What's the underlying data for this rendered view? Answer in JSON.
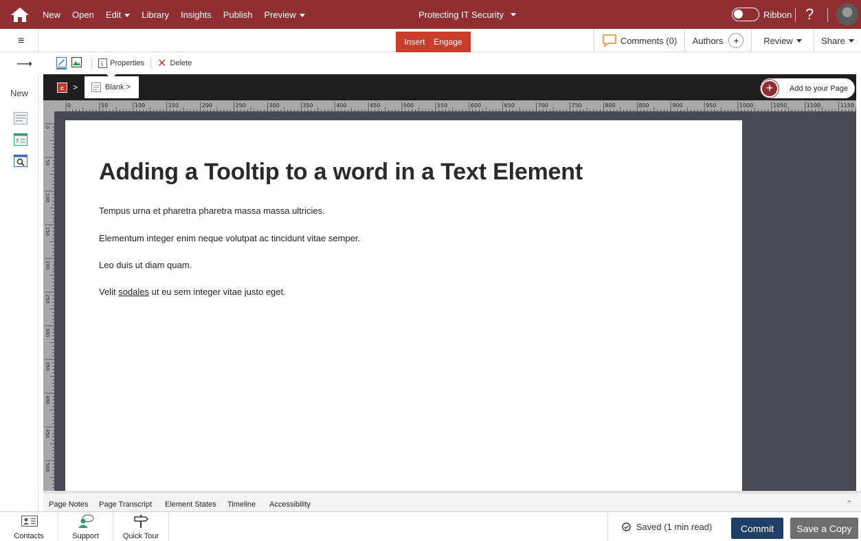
{
  "topbar": {
    "menu": {
      "new": "New",
      "open": "Open",
      "edit": "Edit",
      "library": "Library",
      "insights": "Insights",
      "publish": "Publish",
      "preview": "Preview"
    },
    "course_title": "Protecting IT Security",
    "ribbon_label": "Ribbon",
    "help_label": "?",
    "brand_color": "#8f2f32"
  },
  "toolbar2": {
    "insert_tab": "Insert",
    "engage_tab": "Engage",
    "comments": "Comments (0)",
    "authors": "Authors",
    "authors_add": "+",
    "review": "Review",
    "share": "Share",
    "accent_color": "#c83c2a"
  },
  "toolbar3": {
    "properties": "Properties",
    "delete": "Delete"
  },
  "sidebar": {
    "new_label": "New",
    "icons": [
      "text-layout-icon",
      "quiz-layout-icon",
      "inspect-layout-icon"
    ]
  },
  "breadcrumb": {
    "course_icon_letter": "c",
    "sep": ">",
    "page_label": "Blank >",
    "add_to_page": "Add to your Page",
    "add_plus": "+"
  },
  "ruler": {
    "marks": [
      "0",
      "50",
      "100",
      "150",
      "200",
      "250",
      "300",
      "350",
      "400",
      "450",
      "500",
      "550",
      "600",
      "650",
      "700",
      "750",
      "800",
      "850",
      "900",
      "950",
      "1000",
      "1050",
      "1100",
      "1150"
    ],
    "vmarks": [
      "0",
      "50",
      "100",
      "150",
      "200",
      "250",
      "300",
      "350",
      "400",
      "450",
      "500"
    ]
  },
  "content": {
    "heading": "Adding a Tooltip to a word in a Text Element",
    "p1": "Tempus urna et pharetra pharetra massa massa ultricies.",
    "p2": "Elementum integer enim neque volutpat ac tincidunt vitae semper.",
    "p3": "Leo duis ut diam quam.",
    "p4_before": "Velit ",
    "p4_link": "sodales",
    "p4_after": " ut eu sem integer vitae justo eget."
  },
  "bottom_tabs": [
    "Page Notes",
    "Page Transcript",
    "Element States",
    "Timeline",
    "Accessibility"
  ],
  "footer": {
    "contacts": "Contacts",
    "support": "Support",
    "quick_tour": "Quick Tour",
    "saved": "Saved (1 min read)",
    "commit": "Commit",
    "save_copy": "Save a Copy"
  }
}
